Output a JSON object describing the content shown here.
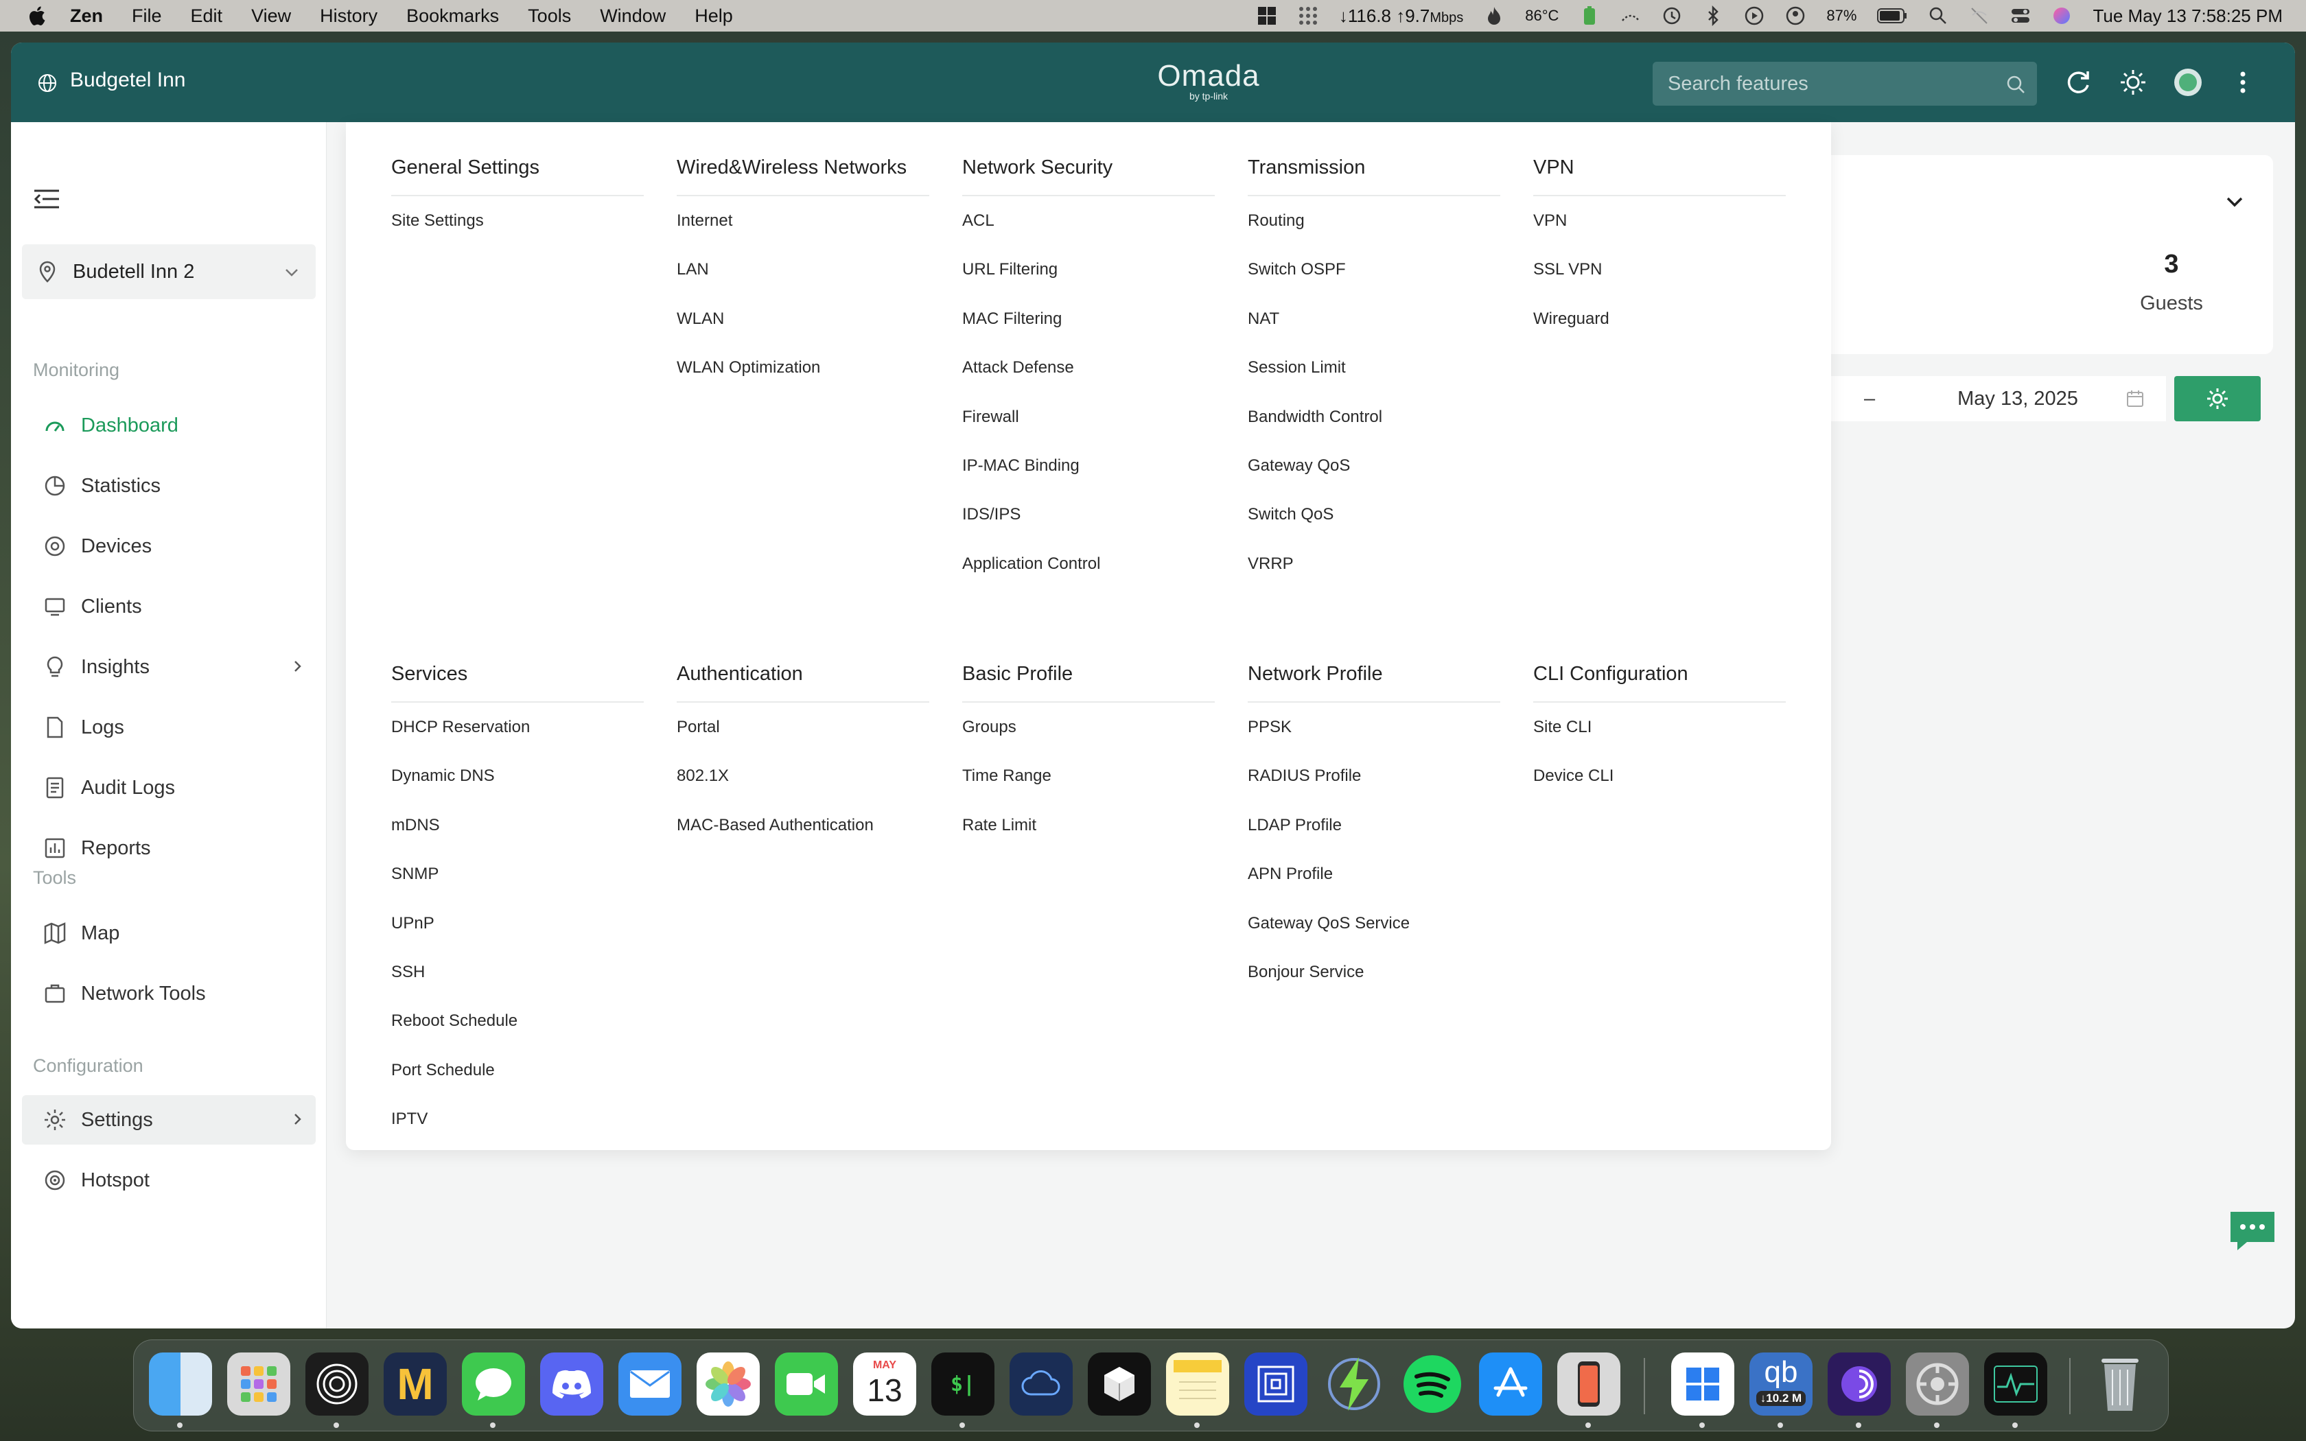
{
  "menubar": {
    "app_name": "Zen",
    "menus": [
      "File",
      "Edit",
      "View",
      "History",
      "Bookmarks",
      "Tools",
      "Window",
      "Help"
    ],
    "network_speed": "↓116.8 ↑9.7",
    "network_unit": "Mbps",
    "temperature": "86°C",
    "battery": "87%",
    "datetime": "Tue May 13  7:58:25 PM"
  },
  "topbar": {
    "site_name": "Budgetel Inn",
    "logo_text": "Omada",
    "logo_sub": "by tp-link",
    "search_placeholder": "Search features"
  },
  "sidebar": {
    "site_select": "Budetell Inn 2",
    "sections": {
      "monitoring": "Monitoring",
      "tools": "Tools",
      "configuration": "Configuration"
    },
    "items": [
      {
        "label": "Dashboard",
        "icon": "dashboard-icon"
      },
      {
        "label": "Statistics",
        "icon": "statistics-icon"
      },
      {
        "label": "Devices",
        "icon": "devices-icon"
      },
      {
        "label": "Clients",
        "icon": "clients-icon"
      },
      {
        "label": "Insights",
        "icon": "insights-icon"
      },
      {
        "label": "Logs",
        "icon": "logs-icon"
      },
      {
        "label": "Audit Logs",
        "icon": "audit-logs-icon"
      },
      {
        "label": "Reports",
        "icon": "reports-icon"
      },
      {
        "label": "Map",
        "icon": "map-icon"
      },
      {
        "label": "Network Tools",
        "icon": "network-tools-icon"
      },
      {
        "label": "Settings",
        "icon": "gear-icon"
      },
      {
        "label": "Hotspot",
        "icon": "hotspot-icon"
      }
    ]
  },
  "dashboard": {
    "guest_count": "3",
    "guest_label": "Guests",
    "date_dash": "–",
    "date": "May 13, 2025"
  },
  "mega_menu": {
    "columns": [
      {
        "title": "General Settings",
        "links": [
          "Site Settings"
        ]
      },
      {
        "title": "Wired&Wireless Networks",
        "links": [
          "Internet",
          "LAN",
          "WLAN",
          "WLAN Optimization"
        ]
      },
      {
        "title": "Network Security",
        "links": [
          "ACL",
          "URL Filtering",
          "MAC Filtering",
          "Attack Defense",
          "Firewall",
          "IP-MAC Binding",
          "IDS/IPS",
          "Application Control"
        ]
      },
      {
        "title": "Transmission",
        "links": [
          "Routing",
          "Switch OSPF",
          "NAT",
          "Session Limit",
          "Bandwidth Control",
          "Gateway QoS",
          "Switch QoS",
          "VRRP"
        ]
      },
      {
        "title": "VPN",
        "links": [
          "VPN",
          "SSL VPN",
          "Wireguard"
        ]
      },
      {
        "title": "Services",
        "links": [
          "DHCP Reservation",
          "Dynamic DNS",
          "mDNS",
          "SNMP",
          "UPnP",
          "SSH",
          "Reboot Schedule",
          "Port Schedule",
          "IPTV"
        ]
      },
      {
        "title": "Authentication",
        "links": [
          "Portal",
          "802.1X",
          "MAC-Based Authentication"
        ]
      },
      {
        "title": "Basic Profile",
        "links": [
          "Groups",
          "Time Range",
          "Rate Limit"
        ]
      },
      {
        "title": "Network Profile",
        "links": [
          "PPSK",
          "RADIUS Profile",
          "LDAP Profile",
          "APN Profile",
          "Gateway QoS Service",
          "Bonjour Service"
        ]
      },
      {
        "title": "CLI Configuration",
        "links": [
          "Site CLI",
          "Device CLI"
        ]
      }
    ]
  },
  "dock": {
    "calendar_month": "MAY",
    "calendar_day": "13",
    "qbittorrent_label": "qb",
    "qbittorrent_speed": "↓10.2 M",
    "apps": [
      "finder",
      "launchpad",
      "circle-app",
      "m-app",
      "messages",
      "discord",
      "mail",
      "photos",
      "facetime",
      "calendar",
      "terminal",
      "cloud-app",
      "box-app",
      "notes",
      "frame-app",
      "bolt-app",
      "spotify",
      "app-store",
      "iphone-mirroring",
      "windows-app",
      "qbittorrent",
      "vpn-app",
      "system-settings",
      "activity-monitor",
      "trash"
    ]
  },
  "colors": {
    "topbar": "#1e5a5a",
    "accent_green": "#1b9a5a",
    "gear_button": "#2e9e6a"
  }
}
